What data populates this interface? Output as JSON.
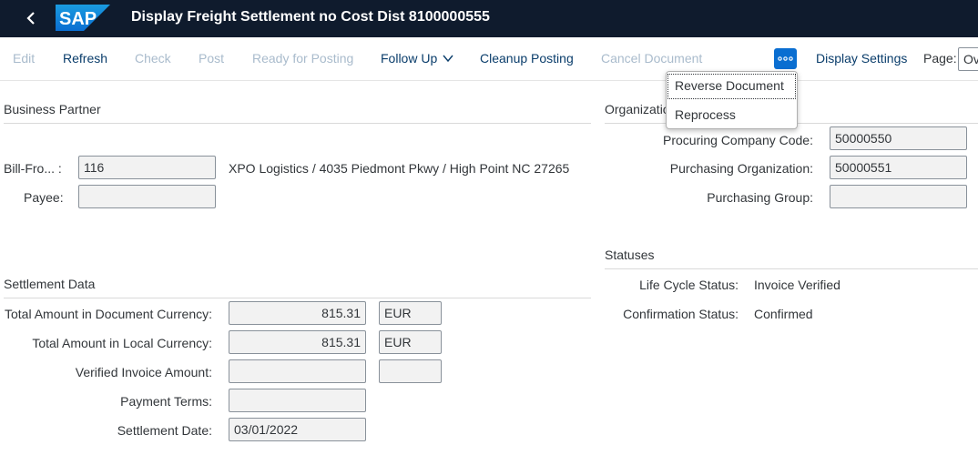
{
  "shell": {
    "title": "Display Freight Settlement no Cost Dist 8100000555",
    "logo_text": "SAP"
  },
  "toolbar": {
    "edit": "Edit",
    "refresh": "Refresh",
    "check": "Check",
    "post": "Post",
    "ready_for_posting": "Ready for Posting",
    "follow_up": "Follow Up",
    "cleanup_posting": "Cleanup Posting",
    "cancel_document": "Cancel Document",
    "overflow_icon": "more-icon",
    "display_settings": "Display Settings",
    "page_label": "Page:",
    "page_value": "Ov"
  },
  "overflow_menu": {
    "items": [
      "Reverse Document",
      "Reprocess"
    ]
  },
  "business_partner": {
    "title": "Business Partner",
    "bill_from_label": "Bill-Fro... :",
    "bill_from_value": "116",
    "bill_from_text": "XPO Logistics / 4035 Piedmont Pkwy / High Point NC 27265",
    "payee_label": "Payee:",
    "payee_value": ""
  },
  "organization": {
    "title": "Organizatio",
    "procuring_company_code_label": "Procuring Company Code:",
    "procuring_company_code_value": "50000550",
    "purchasing_organization_label": "Purchasing Organization:",
    "purchasing_organization_value": "50000551",
    "purchasing_group_label": "Purchasing Group:",
    "purchasing_group_value": ""
  },
  "statuses": {
    "title": "Statuses",
    "life_cycle_label": "Life Cycle Status:",
    "life_cycle_value": "Invoice Verified",
    "confirmation_label": "Confirmation Status:",
    "confirmation_value": "Confirmed"
  },
  "settlement": {
    "title": "Settlement Data",
    "total_doc_label": "Total Amount in Document Currency:",
    "total_doc_value": "815.31",
    "total_doc_currency": "EUR",
    "total_local_label": "Total Amount in Local Currency:",
    "total_local_value": "815.31",
    "total_local_currency": "EUR",
    "verified_label": "Verified Invoice Amount:",
    "verified_value": "",
    "verified_currency": "",
    "payment_terms_label": "Payment Terms:",
    "payment_terms_value": "",
    "settlement_date_label": "Settlement Date:",
    "settlement_date_value": "03/01/2022"
  },
  "colors": {
    "shell_bg": "#0f1b2d",
    "accent": "#0a6ed1",
    "enabled_text": "#0a3d6b",
    "disabled_text": "#a9bbcc"
  }
}
